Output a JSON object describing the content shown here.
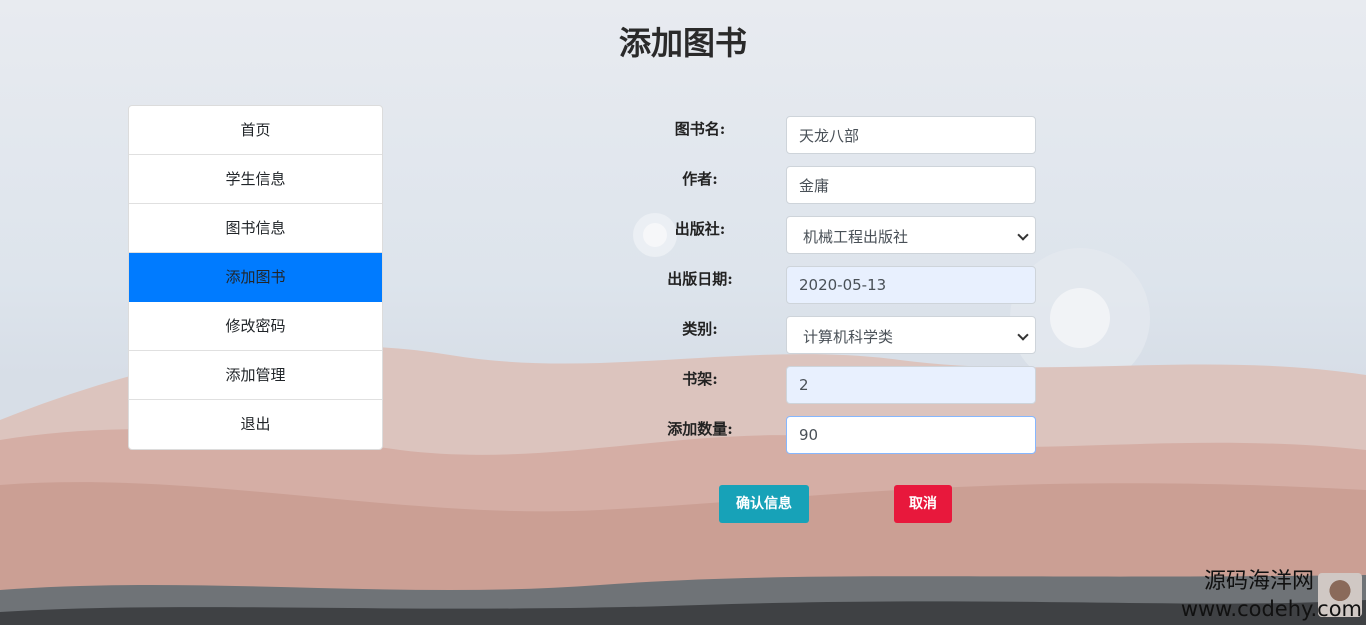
{
  "page": {
    "title": "添加图书"
  },
  "sidebar": {
    "items": [
      {
        "label": "首页"
      },
      {
        "label": "学生信息"
      },
      {
        "label": "图书信息"
      },
      {
        "label": "添加图书",
        "active": true
      },
      {
        "label": "修改密码"
      },
      {
        "label": "添加管理"
      },
      {
        "label": "退出"
      }
    ]
  },
  "form": {
    "book_name": {
      "label": "图书名:",
      "value": "天龙八部"
    },
    "author": {
      "label": "作者:",
      "value": "金庸"
    },
    "publisher": {
      "label": "出版社:",
      "value": "机械工程出版社"
    },
    "publish_date": {
      "label": "出版日期:",
      "value": "2020-05-13"
    },
    "category": {
      "label": "类别:",
      "value": "计算机科学类"
    },
    "shelf": {
      "label": "书架:",
      "value": "2"
    },
    "quantity": {
      "label": "添加数量:",
      "value": "90"
    }
  },
  "buttons": {
    "confirm": "确认信息",
    "cancel": "取消"
  },
  "watermark": {
    "name": "源码海洋网",
    "url": "www.codehy.com"
  },
  "colors": {
    "active_nav": "#007bff",
    "confirm": "#17a2b8",
    "cancel": "#e8183c"
  }
}
